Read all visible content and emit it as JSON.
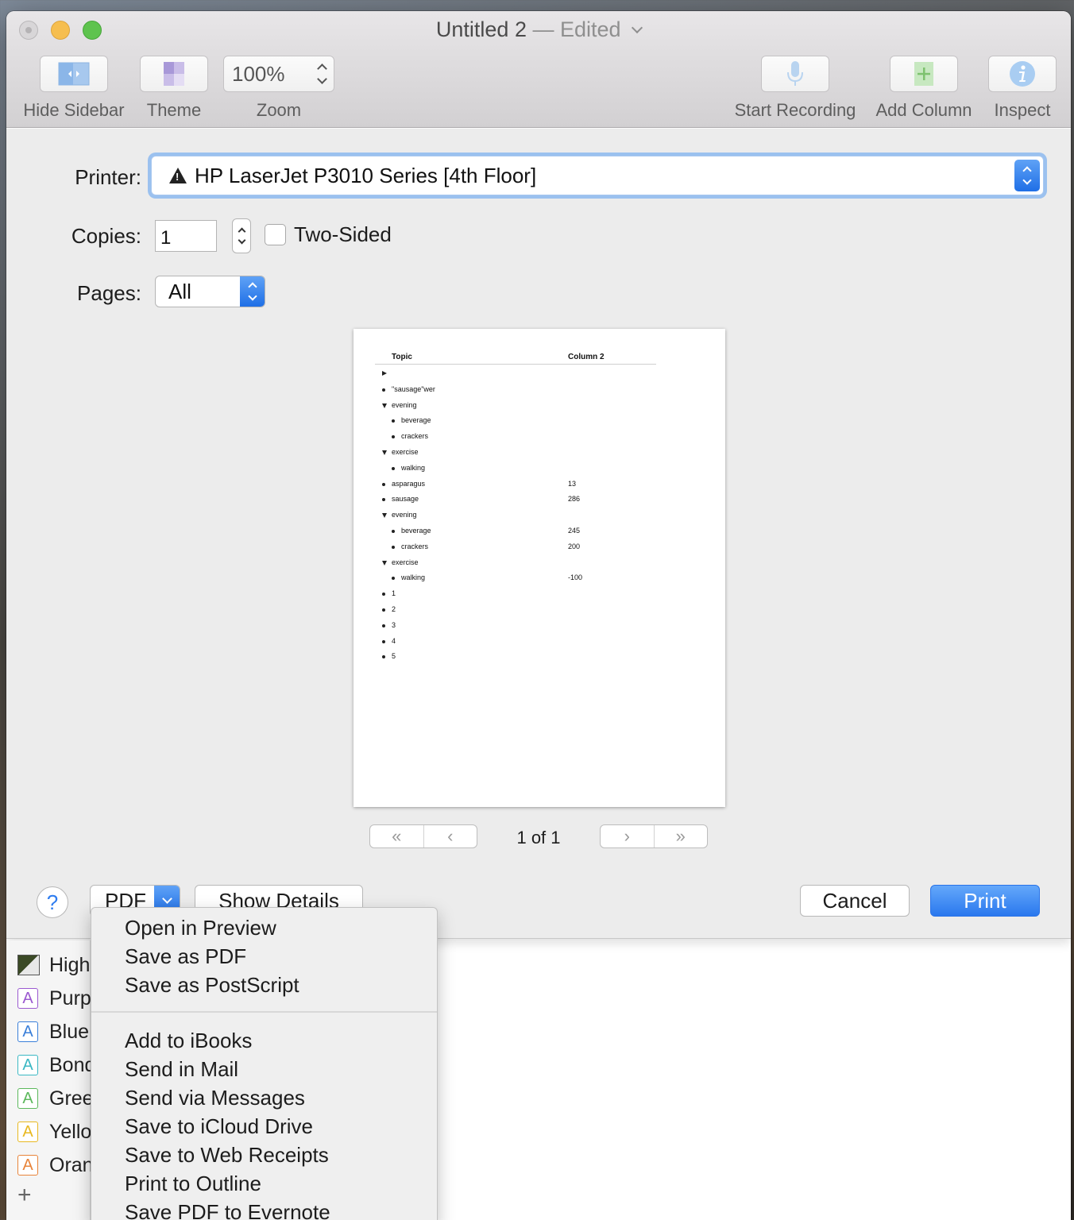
{
  "window": {
    "title": "Untitled 2",
    "separator": "—",
    "status": "Edited"
  },
  "toolbar": {
    "hide_sidebar": "Hide Sidebar",
    "theme": "Theme",
    "zoom_value": "100%",
    "zoom": "Zoom",
    "start_recording": "Start Recording",
    "add_column": "Add Column",
    "inspect": "Inspect"
  },
  "print": {
    "printer_label": "Printer:",
    "printer_name": "HP LaserJet P3010 Series [4th Floor]",
    "copies_label": "Copies:",
    "copies_value": "1",
    "two_sided": "Two-Sided",
    "pages_label": "Pages:",
    "pages_value": "All",
    "page_count": "1 of 1",
    "help": "?",
    "pdf": "PDF",
    "show_details": "Show Details",
    "cancel": "Cancel",
    "print": "Print"
  },
  "preview": {
    "col1": "Topic",
    "col2": "Column 2",
    "rows": [
      {
        "text": "",
        "value": "",
        "mark": "tri-right",
        "indent": 0
      },
      {
        "text": "\"sausage\"wer",
        "value": "",
        "mark": "dot",
        "indent": 0
      },
      {
        "text": "evening",
        "value": "",
        "mark": "tri-down",
        "indent": 0
      },
      {
        "text": "beverage",
        "value": "",
        "mark": "dot",
        "indent": 1
      },
      {
        "text": "crackers",
        "value": "",
        "mark": "dot",
        "indent": 1
      },
      {
        "text": "exercise",
        "value": "",
        "mark": "tri-down",
        "indent": 0
      },
      {
        "text": "walking",
        "value": "",
        "mark": "dot",
        "indent": 1
      },
      {
        "text": "asparagus",
        "value": "13",
        "mark": "dot",
        "indent": 0
      },
      {
        "text": "sausage",
        "value": "286",
        "mark": "dot",
        "indent": 0
      },
      {
        "text": "evening",
        "value": "",
        "mark": "tri-down",
        "indent": 0
      },
      {
        "text": "beverage",
        "value": "245",
        "mark": "dot",
        "indent": 1
      },
      {
        "text": "crackers",
        "value": "200",
        "mark": "dot",
        "indent": 1
      },
      {
        "text": "exercise",
        "value": "",
        "mark": "tri-down",
        "indent": 0
      },
      {
        "text": "walking",
        "value": "-100",
        "mark": "dot",
        "indent": 1
      },
      {
        "text": "1",
        "value": "",
        "mark": "dot",
        "indent": 0
      },
      {
        "text": "2",
        "value": "",
        "mark": "dot",
        "indent": 0
      },
      {
        "text": "3",
        "value": "",
        "mark": "dot",
        "indent": 0
      },
      {
        "text": "4",
        "value": "",
        "mark": "dot",
        "indent": 0
      },
      {
        "text": "5",
        "value": "",
        "mark": "dot",
        "indent": 0
      }
    ]
  },
  "pdf_menu": {
    "group1": [
      "Open in Preview",
      "Save as PDF",
      "Save as PostScript"
    ],
    "group2": [
      "Add to iBooks",
      "Send in Mail",
      "Send via Messages",
      "Save to iCloud Drive",
      "Save to Web Receipts",
      "Print to Outline",
      "Save PDF to Evernote"
    ]
  },
  "background_sidebar": {
    "items": [
      {
        "label": "High",
        "icon": "highlight-swatch"
      },
      {
        "label": "Purp",
        "icon": "A",
        "color": "#9b59d0"
      },
      {
        "label": "Blue",
        "icon": "A",
        "color": "#3a7fd9"
      },
      {
        "label": "Bond",
        "icon": "A",
        "color": "#3bb8c4"
      },
      {
        "label": "Gree",
        "icon": "A",
        "color": "#5cb85c"
      },
      {
        "label": "Yello",
        "icon": "A",
        "color": "#e8b820"
      },
      {
        "label": "Oran",
        "icon": "A",
        "color": "#e8843a"
      }
    ],
    "add": "+"
  },
  "colors": {
    "accent": "#2a78ee",
    "warning_icon": "#222222"
  }
}
